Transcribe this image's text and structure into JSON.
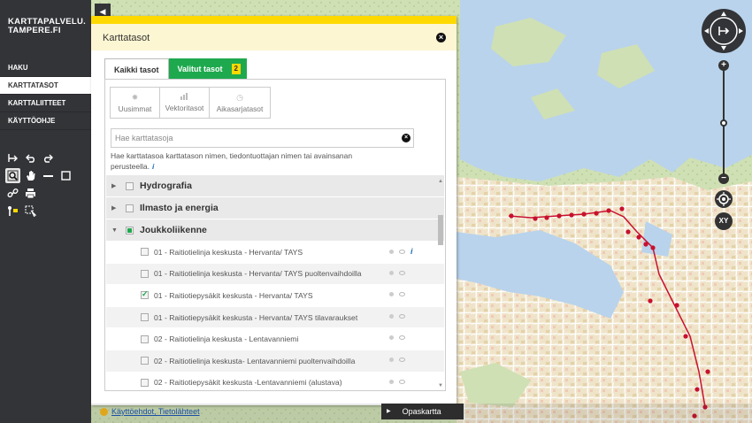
{
  "logo": {
    "line1": "KARTTAPALVELU.",
    "line2": "TAMPERE.FI"
  },
  "nav": [
    {
      "label": "HAKU",
      "active": false
    },
    {
      "label": "KARTTATASOT",
      "active": true
    },
    {
      "label": "KARTTALIITTEET",
      "active": false
    },
    {
      "label": "KÄYTTÖOHJE",
      "active": false
    }
  ],
  "flyout": {
    "title": "Karttatasot",
    "tabs": {
      "all": "Kaikki tasot",
      "selected": "Valitut tasot",
      "selected_count": "2"
    },
    "filters": [
      "Uusimmat",
      "Vektoritasot",
      "Aikasarjatasot"
    ],
    "search": {
      "placeholder": "Hae karttatasoja",
      "value": ""
    },
    "help_text": "Hae karttatasoa karttatason nimen, tiedontuottajan nimen tai avainsanan perusteella.",
    "groups": [
      {
        "label": "Hydrografia",
        "expanded": false
      },
      {
        "label": "Ilmasto ja energia",
        "expanded": false
      },
      {
        "label": "Joukkoliikenne",
        "expanded": true
      }
    ],
    "layers": [
      {
        "label": "01 - Raitiotielinja keskusta - Hervanta/ TAYS",
        "checked": false,
        "info": true
      },
      {
        "label": "01 - Raitiotielinja keskusta - Hervanta/ TAYS puoltenvaihdoilla",
        "checked": false,
        "info": false
      },
      {
        "label": "01 - Raitiotiepysäkit keskusta - Hervanta/ TAYS",
        "checked": true,
        "info": false
      },
      {
        "label": "01 - Raitiotiepysäkit keskusta - Hervanta/ TAYS tilavaraukset",
        "checked": false,
        "info": false
      },
      {
        "label": "02 - Raitiotielinja keskusta - Lentavanniemi",
        "checked": false,
        "info": false
      },
      {
        "label": "02 - Raitiotielinja keskusta- Lentavanniemi puoltenvaihdoilla",
        "checked": false,
        "info": false
      },
      {
        "label": "02 - Raitiotiepysäkit keskusta -Lentavanniemi (alustava)",
        "checked": false,
        "info": false
      }
    ]
  },
  "bottom": {
    "terms_link": "Käyttöehdot, Tietolähteet",
    "guide_button": "Opaskartta"
  },
  "map_controls": {
    "zoom_in": "+",
    "zoom_out": "−",
    "xy": "XY"
  },
  "colors": {
    "accent_yellow": "#fdd900",
    "accent_green": "#1ea94e",
    "sidebar": "#333438",
    "stop_red": "#c8102e"
  }
}
